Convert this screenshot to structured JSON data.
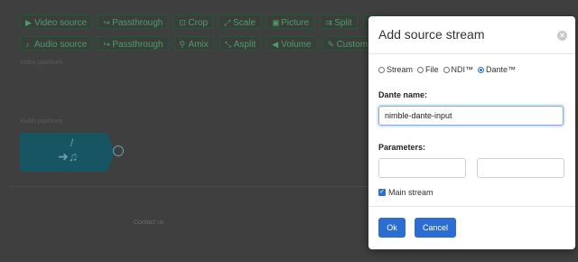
{
  "background": {
    "toolbar_row1": [
      {
        "icon": "video-icon",
        "glyph": "▶",
        "label": "Video source"
      },
      {
        "icon": "passthrough-icon",
        "glyph": "↪",
        "label": "Passthrough"
      },
      {
        "icon": "crop-icon",
        "glyph": "⊡",
        "label": "Crop"
      },
      {
        "icon": "scale-icon",
        "glyph": "⤢",
        "label": "Scale"
      },
      {
        "icon": "picture-icon",
        "glyph": "▣",
        "label": "Picture"
      },
      {
        "icon": "split-icon",
        "glyph": "⇉",
        "label": "Split"
      },
      {
        "icon": "more-icon",
        "glyph": "▼",
        "label": ""
      }
    ],
    "toolbar_row2": [
      {
        "icon": "audio-icon",
        "glyph": "♪",
        "label": "Audio source"
      },
      {
        "icon": "passthrough-icon",
        "glyph": "↪",
        "label": "Passthrough"
      },
      {
        "icon": "amix-icon",
        "glyph": "⚲",
        "label": "Amix"
      },
      {
        "icon": "asplit-icon",
        "glyph": "⤡",
        "label": "Asplit"
      },
      {
        "icon": "volume-icon",
        "glyph": "◀",
        "label": "Volume"
      },
      {
        "icon": "custom-icon",
        "glyph": "✎",
        "label": "Custom"
      }
    ],
    "video_section_label": "Video pipelines",
    "audio_section_label": "Audio pipelines",
    "audio_card_slash": "/",
    "footer_text": "Contact us"
  },
  "modal": {
    "title": "Add source stream",
    "close_glyph": "×",
    "source_types": [
      {
        "label": "Stream",
        "selected": false
      },
      {
        "label": "File",
        "selected": false
      },
      {
        "label": "NDI™",
        "selected": false
      },
      {
        "label": "Dante™",
        "selected": true
      }
    ],
    "dante_name_label": "Dante name:",
    "dante_name_value": "nimble-dante-input",
    "parameters_label": "Parameters:",
    "parameter_1": "",
    "parameter_2": "",
    "main_stream_label": "Main stream",
    "main_stream_checked": true,
    "ok_label": "Ok",
    "cancel_label": "Cancel"
  },
  "colors": {
    "primary_button": "#2c6dd2",
    "overlay": "#3f3f3f",
    "audio_card": "#175563",
    "toolbar_button_text": "#4f9a6a"
  }
}
